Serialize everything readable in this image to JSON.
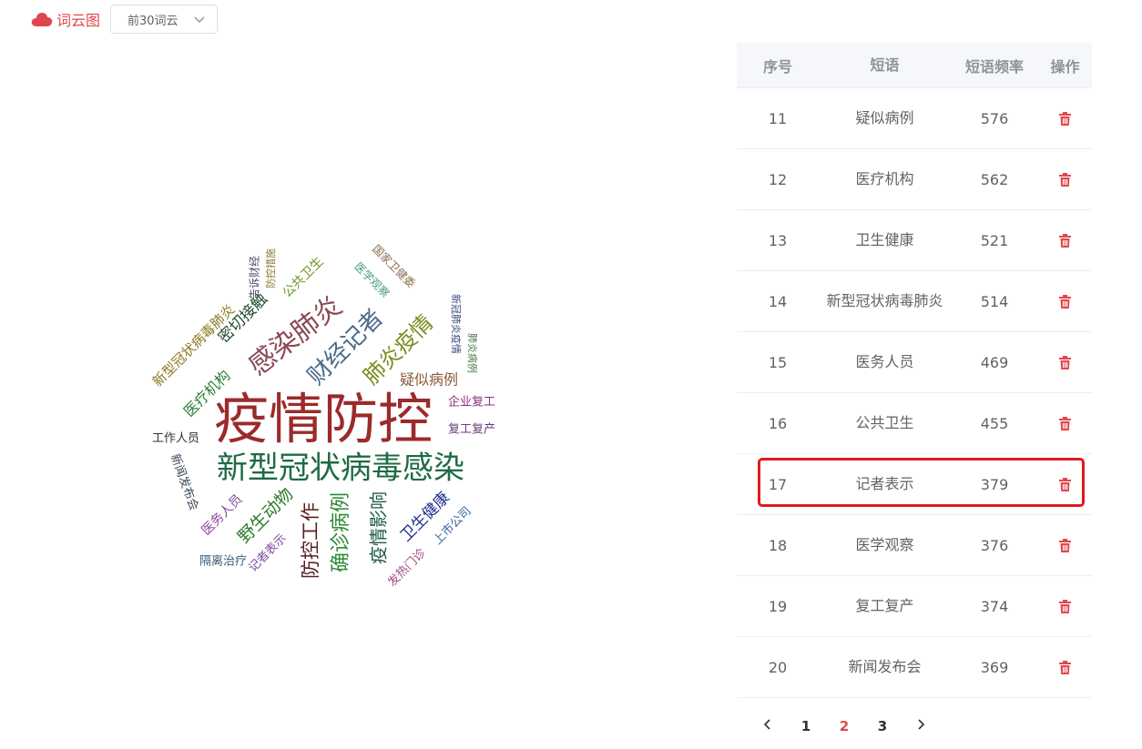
{
  "header": {
    "title": "词云图",
    "select_value": "前30词云",
    "accent_color": "#e0474c"
  },
  "wordcloud": [
    {
      "text": "疫情防控",
      "color": "#9c2a2a"
    },
    {
      "text": "新型冠状病毒感染",
      "color": "#1d6b43"
    },
    {
      "text": "感染肺炎",
      "color": "#8a4a55"
    },
    {
      "text": "财经记者",
      "color": "#4d6a8a"
    },
    {
      "text": "肺炎疫情",
      "color": "#7d8a1e"
    },
    {
      "text": "确诊病例",
      "color": "#2f8a37"
    },
    {
      "text": "防控工作",
      "color": "#5a1f1f"
    },
    {
      "text": "疫情影响",
      "color": "#1e5a4a"
    },
    {
      "text": "野生动物",
      "color": "#2e7a2e"
    },
    {
      "text": "卫生健康",
      "color": "#1f2e8a"
    },
    {
      "text": "密切接触",
      "color": "#1f4a2a"
    },
    {
      "text": "新型冠状病毒肺炎",
      "color": "#8a7a1f"
    },
    {
      "text": "医疗机构",
      "color": "#2e7a3a"
    },
    {
      "text": "疑似病例",
      "color": "#8a5a3a"
    },
    {
      "text": "企业复工",
      "color": "#8a2e7a"
    },
    {
      "text": "复工复产",
      "color": "#6a3a7a"
    },
    {
      "text": "医务人员",
      "color": "#8a4aa0"
    },
    {
      "text": "工作人员",
      "color": "#333333"
    },
    {
      "text": "新闻发布会",
      "color": "#3a4a5a"
    },
    {
      "text": "隔离治疗",
      "color": "#3a5a7a"
    },
    {
      "text": "记者表示",
      "color": "#7a4aa0"
    },
    {
      "text": "发热门诊",
      "color": "#a04a8a"
    },
    {
      "text": "上市公司",
      "color": "#3a6aa0"
    },
    {
      "text": "公共卫生",
      "color": "#6a9a2a"
    },
    {
      "text": "告诉财经",
      "color": "#4a4a6a"
    },
    {
      "text": "防控措施",
      "color": "#8a7a2a"
    },
    {
      "text": "国家卫健委",
      "color": "#8a6a4a"
    },
    {
      "text": "医学观察",
      "color": "#4a9a7a"
    },
    {
      "text": "新冠肺炎疫情",
      "color": "#3a4a7a"
    },
    {
      "text": "肺炎病例",
      "color": "#4a7a4a"
    }
  ],
  "table": {
    "headers": [
      "序号",
      "短语",
      "短语频率",
      "操作"
    ],
    "rows": [
      {
        "no": "11",
        "phrase": "疑似病例",
        "freq": "576"
      },
      {
        "no": "12",
        "phrase": "医疗机构",
        "freq": "562"
      },
      {
        "no": "13",
        "phrase": "卫生健康",
        "freq": "521"
      },
      {
        "no": "14",
        "phrase": "新型冠状病毒肺炎",
        "freq": "514"
      },
      {
        "no": "15",
        "phrase": "医务人员",
        "freq": "469"
      },
      {
        "no": "16",
        "phrase": "公共卫生",
        "freq": "455"
      },
      {
        "no": "17",
        "phrase": "记者表示",
        "freq": "379"
      },
      {
        "no": "18",
        "phrase": "医学观察",
        "freq": "376"
      },
      {
        "no": "19",
        "phrase": "复工复产",
        "freq": "374"
      },
      {
        "no": "20",
        "phrase": "新闻发布会",
        "freq": "369"
      }
    ],
    "delete_icon": "trash-icon",
    "delete_color": "#e0474c",
    "highlighted_row": "17",
    "highlight_color": "#e1191e"
  },
  "pagination": {
    "pages": [
      "1",
      "2",
      "3"
    ],
    "current": "2"
  }
}
